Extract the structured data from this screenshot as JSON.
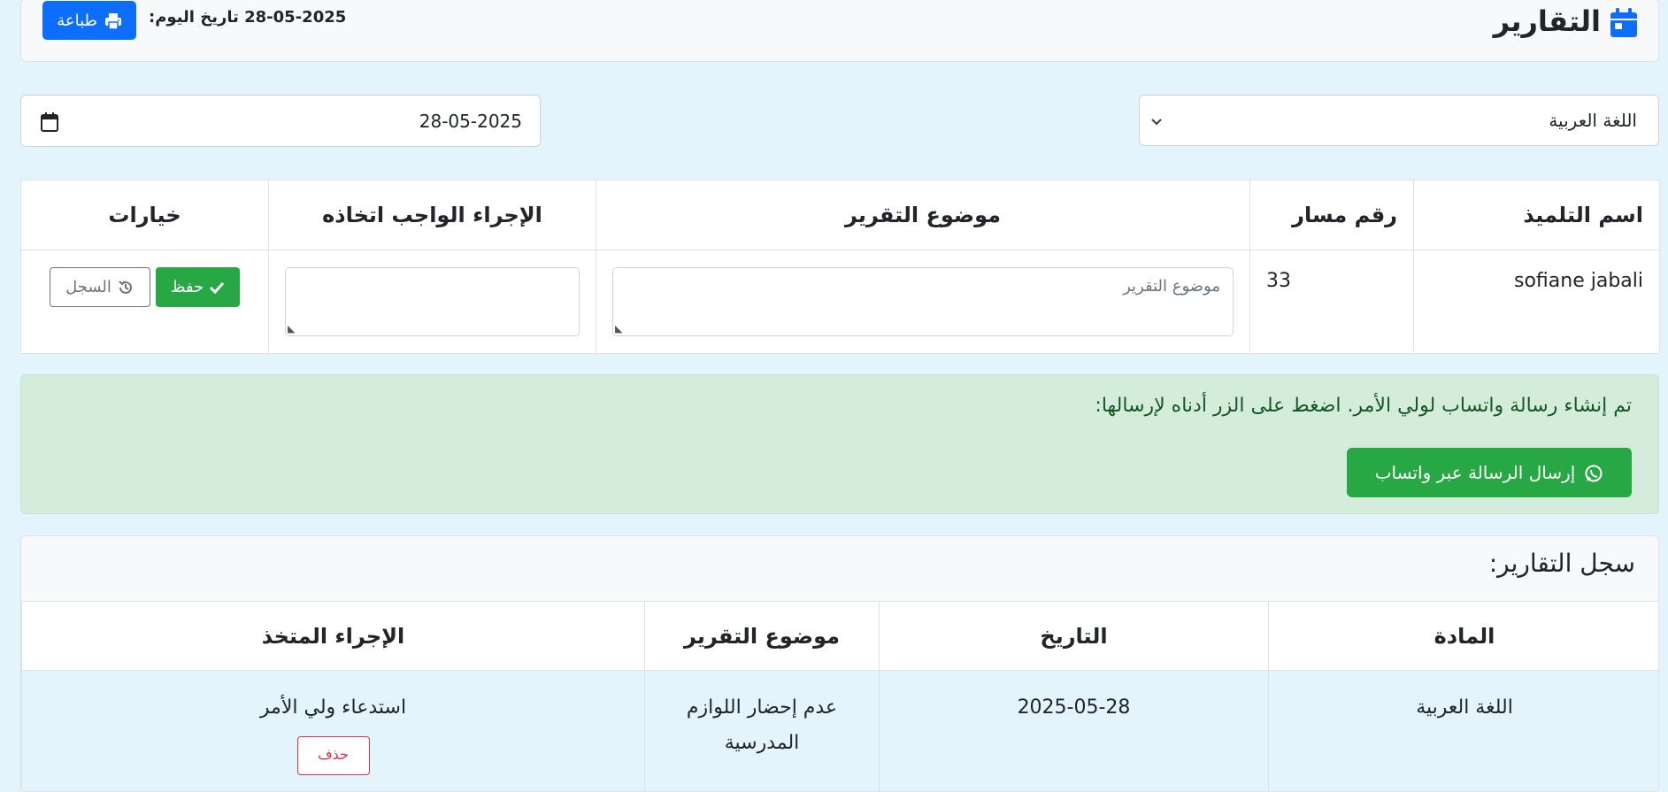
{
  "header": {
    "title": "التقارير",
    "today_label": "تاريخ اليوم:",
    "today_value": "28-05-2025",
    "print_label": "طباعة"
  },
  "controls": {
    "subject_selected": "اللغة العربية",
    "date_value": "28-05-2025"
  },
  "main_table": {
    "headers": [
      "اسم التلميذ",
      "رقم مسار",
      "موضوع التقرير",
      "الإجراء الواجب اتخاذه",
      "خيارات"
    ],
    "row": {
      "student_name": "sofiane jabali",
      "massar_number": "33",
      "report_topic_placeholder": "موضوع التقرير",
      "action_value": "",
      "save_label": "حفظ",
      "history_label": "السجل"
    }
  },
  "alert": {
    "message": "تم إنشاء رسالة واتساب لولي الأمر. اضغط على الزر أدناه لإرسالها:",
    "whatsapp_button": "إرسال الرسالة عبر واتساب"
  },
  "history": {
    "title": "سجل التقارير:",
    "headers": [
      "المادة",
      "التاريخ",
      "موضوع التقرير",
      "الإجراء المتخذ"
    ],
    "rows": [
      {
        "subject": "اللغة العربية",
        "date": "2025-05-28",
        "topic": "عدم إحضار اللوازم المدرسية",
        "action": "استدعاء ولي الأمر",
        "delete_label": "حذف"
      }
    ]
  },
  "colors": {
    "background": "#e4f4fd",
    "primary": "#0d6efd",
    "success": "#28a745",
    "danger": "#dc3545",
    "alert_bg": "#d4edda"
  }
}
